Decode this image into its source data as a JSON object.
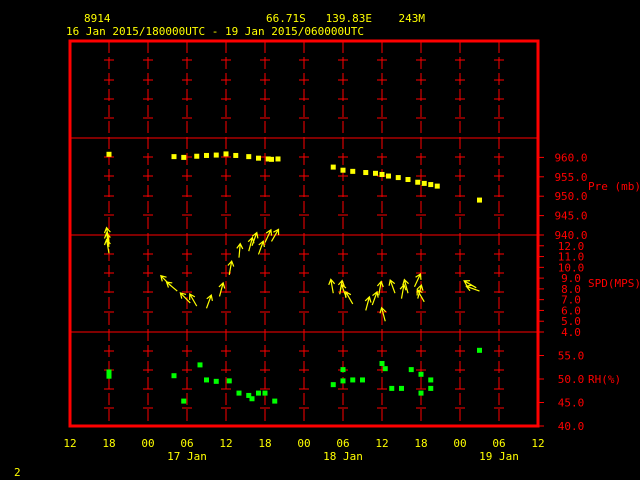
{
  "header": {
    "station_id": "8914",
    "location": "66.71S   139.83E    243M",
    "date_range": "16 Jan 2015/180000UTC - 19 Jan 2015/060000UTC"
  },
  "page_number": "2",
  "colors": {
    "background": "#000000",
    "frame": "#ff0000",
    "text": "#ffff00",
    "pressure": "#ffff00",
    "wind": "#ffff00",
    "rh": "#00ff00"
  },
  "chart_data": {
    "type": "scatter",
    "x_axis": {
      "ticks": [
        "12",
        "18",
        "00",
        "06",
        "12",
        "18",
        "00",
        "06",
        "12",
        "18",
        "00",
        "06",
        "12"
      ],
      "day_labels": [
        {
          "label": "17 Jan",
          "hour": 12
        },
        {
          "label": "18 Jan",
          "hour": 36
        },
        {
          "label": "19 Jan",
          "hour": 60
        }
      ],
      "range_hours": [
        -6,
        66
      ]
    },
    "panels": [
      {
        "id": "pressure",
        "label": "Pre (mb)",
        "ylim": [
          940,
          965
        ],
        "tick_labels": [
          "940.0",
          "945.0",
          "950.0",
          "955.0",
          "960.0"
        ],
        "tick_values": [
          940,
          945,
          950,
          955,
          960
        ],
        "points": [
          [
            0,
            960.8
          ],
          [
            10,
            960.2
          ],
          [
            11.5,
            960.0
          ],
          [
            13.5,
            960.3
          ],
          [
            15,
            960.5
          ],
          [
            16.5,
            960.6
          ],
          [
            18,
            960.9
          ],
          [
            19.5,
            960.5
          ],
          [
            21.5,
            960.2
          ],
          [
            23,
            959.8
          ],
          [
            24.5,
            959.6
          ],
          [
            25,
            959.5
          ],
          [
            26,
            959.6
          ],
          [
            34.5,
            957.5
          ],
          [
            36,
            956.7
          ],
          [
            37.5,
            956.4
          ],
          [
            39.5,
            956.1
          ],
          [
            41,
            955.9
          ],
          [
            42,
            955.6
          ],
          [
            43,
            955.2
          ],
          [
            44.5,
            954.8
          ],
          [
            46,
            954.3
          ],
          [
            47.5,
            953.6
          ],
          [
            48.5,
            953.3
          ],
          [
            49.5,
            953.0
          ],
          [
            50.5,
            952.6
          ],
          [
            57,
            949.0
          ]
        ]
      },
      {
        "id": "wind",
        "label": "SPD(MPS)",
        "ylim": [
          4,
          13
        ],
        "tick_labels": [
          "4.0",
          "5.0",
          "6.0",
          "7.0",
          "8.0",
          "9.0",
          "10.0",
          "11.0",
          "12.0"
        ],
        "tick_values": [
          4,
          5,
          6,
          7,
          8,
          9,
          10,
          11,
          12
        ],
        "points": [
          [
            0,
            11.3,
            -10
          ],
          [
            0,
            11.9,
            -10
          ],
          [
            0,
            12.4,
            -10
          ],
          [
            9.5,
            8.3,
            -45
          ],
          [
            10.5,
            7.8,
            -50
          ],
          [
            12.5,
            6.7,
            -45
          ],
          [
            13.5,
            6.4,
            -30
          ],
          [
            15,
            6.2,
            20
          ],
          [
            17,
            7.3,
            15
          ],
          [
            18.5,
            9.3,
            10
          ],
          [
            20,
            10.9,
            5
          ],
          [
            21.5,
            11.5,
            15
          ],
          [
            22,
            12.0,
            20
          ],
          [
            23,
            11.2,
            20
          ],
          [
            24,
            12.3,
            25
          ],
          [
            25,
            12.4,
            30
          ],
          [
            34.5,
            7.6,
            -10
          ],
          [
            35.5,
            7.5,
            10
          ],
          [
            36.5,
            7.2,
            -20
          ],
          [
            37.5,
            6.6,
            -30
          ],
          [
            39.5,
            6.0,
            15
          ],
          [
            40.5,
            6.5,
            20
          ],
          [
            41.5,
            7.4,
            10
          ],
          [
            42.5,
            5.0,
            -15
          ],
          [
            44,
            7.6,
            -20
          ],
          [
            45,
            7.1,
            10
          ],
          [
            46,
            7.6,
            -15
          ],
          [
            47,
            8.2,
            25
          ],
          [
            47.5,
            7.1,
            15
          ],
          [
            48.5,
            6.8,
            -30
          ],
          [
            56.5,
            8.1,
            -60
          ],
          [
            57,
            7.8,
            -70
          ]
        ]
      },
      {
        "id": "rh",
        "label": "RH(%)",
        "ylim": [
          40,
          60
        ],
        "tick_labels": [
          "40.0",
          "45.0",
          "50.0",
          "55.0"
        ],
        "tick_values": [
          40,
          45,
          50,
          55
        ],
        "points": [
          [
            0,
            51.5
          ],
          [
            0,
            50.6
          ],
          [
            10,
            50.7
          ],
          [
            11.5,
            45.3
          ],
          [
            14,
            53.0
          ],
          [
            15,
            49.8
          ],
          [
            16.5,
            49.5
          ],
          [
            18.5,
            49.6
          ],
          [
            20,
            47.0
          ],
          [
            21.5,
            46.5
          ],
          [
            22,
            45.8
          ],
          [
            23,
            47.0
          ],
          [
            24,
            47.0
          ],
          [
            25.5,
            45.3
          ],
          [
            34.5,
            48.8
          ],
          [
            36,
            49.6
          ],
          [
            36,
            52.0
          ],
          [
            37.5,
            49.8
          ],
          [
            39,
            49.8
          ],
          [
            42,
            53.3
          ],
          [
            42.5,
            52.2
          ],
          [
            43.5,
            48.0
          ],
          [
            45,
            48.0
          ],
          [
            46.5,
            52.0
          ],
          [
            48,
            51.0
          ],
          [
            48,
            47.0
          ],
          [
            49.5,
            49.8
          ],
          [
            49.5,
            48.0
          ],
          [
            57,
            56.1
          ]
        ]
      }
    ]
  }
}
